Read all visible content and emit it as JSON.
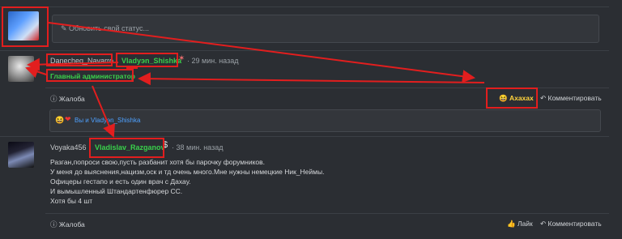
{
  "status": {
    "placeholder": "Обновить свой статус..."
  },
  "post1": {
    "author": "Danecheq_Navarro",
    "mention": "Vladyэn_Shishka",
    "time": "· 29 мин. назад",
    "rank": "Главный администратор",
    "report": "Жалоба",
    "reaction": "Ахахах",
    "comment": "Комментировать",
    "reacted_by": "Вы и Vladyэn_Shishka"
  },
  "post2": {
    "author": "Voyaka456",
    "mention": "Vladislav_Razganov",
    "time": "· 38 мин. назад",
    "lines": [
      "Разган,попроси свою,пусть разбанит хотя бы парочку форумников.",
      "У меня до выяснения,нацизм,оск и тд очень много.Мне нужны немецкие Ник_Неймы.",
      "Офицеры гестапо и есть один врач с Дахау.",
      "И вымышленный Штандартенфюрер СС.",
      "Хотя бы 4 шт"
    ],
    "report": "Жалоба",
    "like": "Лайк",
    "comment": "Комментировать"
  },
  "colors": {
    "accent_red": "#e21e1e",
    "green": "#39d14b",
    "link": "#4ea1ff"
  }
}
